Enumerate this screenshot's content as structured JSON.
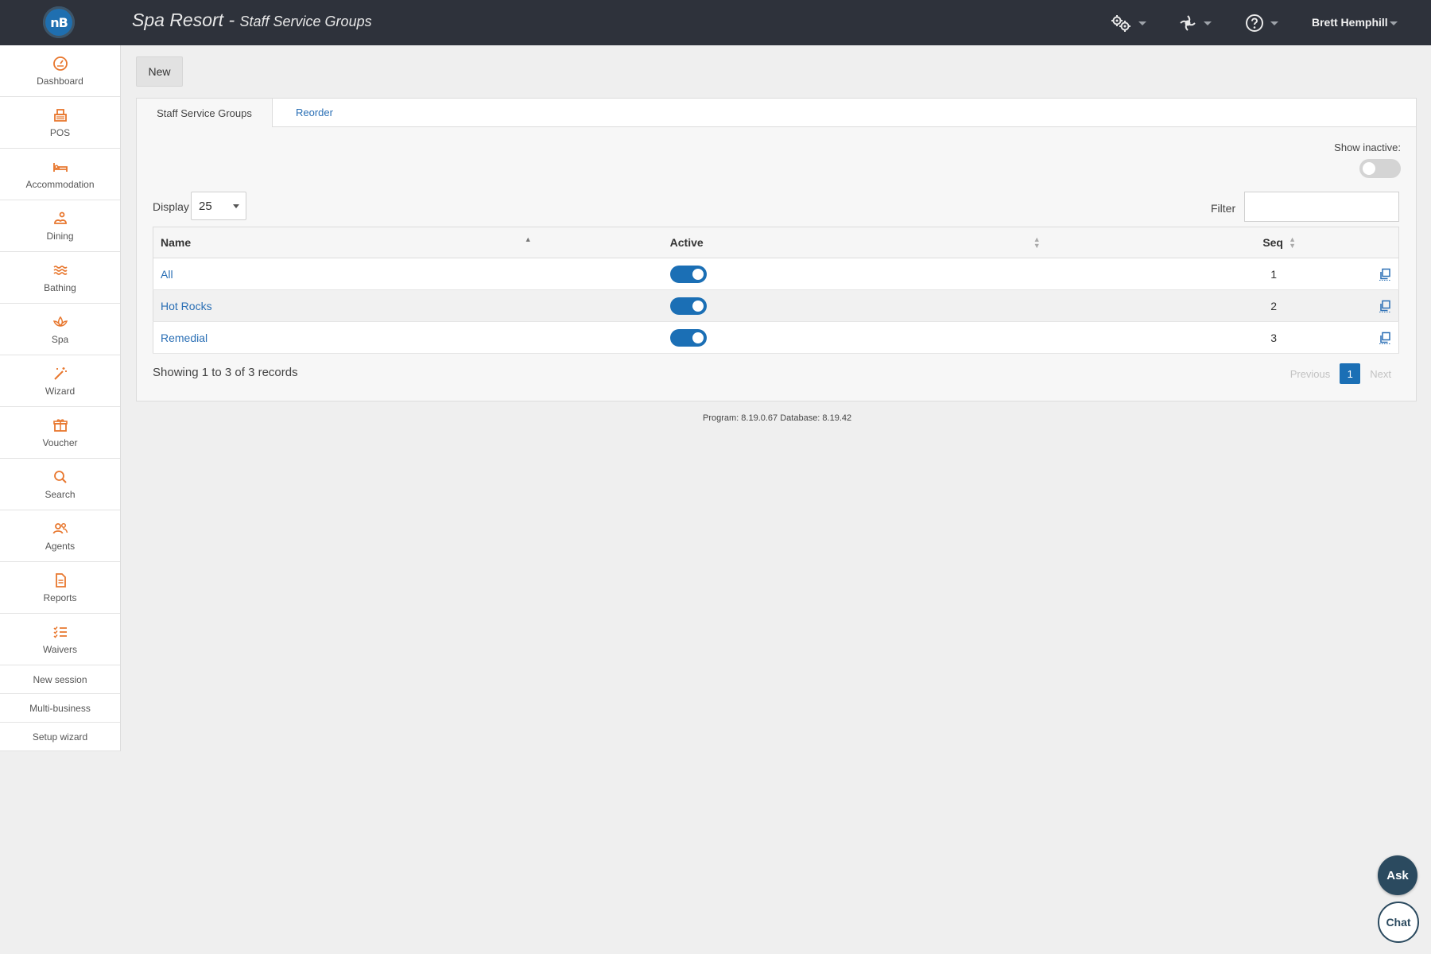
{
  "header": {
    "logo_text": "nB",
    "app_title": "Spa Resort",
    "separator": " - ",
    "page_title": "Staff Service Groups",
    "icons": [
      "settings-gears-icon",
      "integrations-icon",
      "help-icon"
    ],
    "user_name": "Brett Hemphill"
  },
  "sidebar": {
    "items": [
      {
        "label": "Dashboard",
        "icon": "gauge-icon"
      },
      {
        "label": "POS",
        "icon": "register-icon"
      },
      {
        "label": "Accommodation",
        "icon": "bed-icon"
      },
      {
        "label": "Dining",
        "icon": "dining-icon"
      },
      {
        "label": "Bathing",
        "icon": "waves-icon"
      },
      {
        "label": "Spa",
        "icon": "lotus-icon"
      },
      {
        "label": "Wizard",
        "icon": "magic-wand-icon"
      },
      {
        "label": "Voucher",
        "icon": "gift-icon"
      },
      {
        "label": "Search",
        "icon": "search-icon"
      },
      {
        "label": "Agents",
        "icon": "agents-icon"
      },
      {
        "label": "Reports",
        "icon": "document-icon"
      },
      {
        "label": "Waivers",
        "icon": "checklist-icon"
      }
    ],
    "text_links": [
      "New session",
      "Multi-business",
      "Setup wizard"
    ],
    "icon_color": "#e8772e"
  },
  "toolbar": {
    "new_label": "New"
  },
  "tabs": [
    {
      "label": "Staff Service Groups",
      "active": true
    },
    {
      "label": "Reorder",
      "active": false
    }
  ],
  "options": {
    "show_inactive_label": "Show inactive:",
    "show_inactive": false,
    "display_label": "Display",
    "display_value": "25",
    "filter_label": "Filter",
    "filter_value": ""
  },
  "table": {
    "columns": [
      "Name",
      "Active",
      "Seq"
    ],
    "rows": [
      {
        "name": "All",
        "active": true,
        "seq": "1"
      },
      {
        "name": "Hot Rocks",
        "active": true,
        "seq": "2"
      },
      {
        "name": "Remedial",
        "active": true,
        "seq": "3"
      }
    ]
  },
  "footer": {
    "showing": "Showing 1 to 3 of 3 records",
    "previous": "Previous",
    "current_page": "1",
    "next": "Next",
    "version": "Program: 8.19.0.67 Database: 8.19.42"
  },
  "floating": {
    "ask": "Ask",
    "chat": "Chat"
  },
  "colors": {
    "accent": "#1b6fb5",
    "topbar": "#2e323b",
    "nav_icon": "#e8772e"
  }
}
